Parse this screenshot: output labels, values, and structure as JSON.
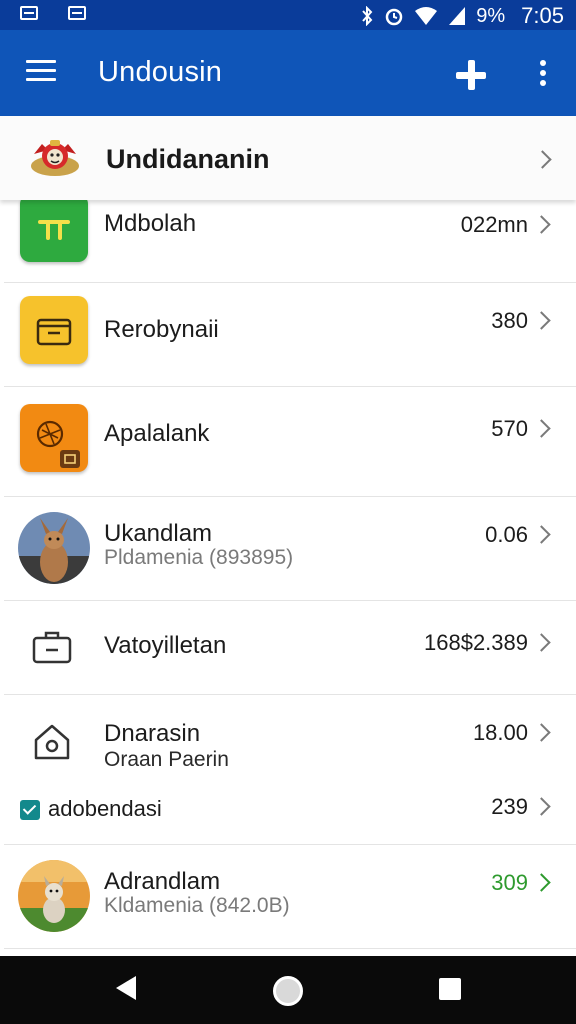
{
  "status_bar": {
    "battery": "9%",
    "time": "7:05",
    "icons": [
      "notification-icon",
      "notification-icon",
      "bluetooth-icon",
      "alarm-icon",
      "wifi-icon",
      "signal-icon"
    ]
  },
  "app_bar": {
    "title": "Undousin",
    "color": "#0f55b8",
    "status_color": "#0a3c9a"
  },
  "header": {
    "title": "Undidananin",
    "icon": "emblem-logo"
  },
  "list": [
    {
      "icon": "green-tile-icon",
      "tile_color": "#2eaa3f",
      "title": "Mdbolah",
      "subtitle": "",
      "value": "022mn"
    },
    {
      "icon": "wallet-icon",
      "tile_color": "#f6c22c",
      "title": "Rerobynaii",
      "subtitle": "",
      "value": "380"
    },
    {
      "icon": "fruit-icon",
      "tile_color": "#f28a12",
      "title": "Apalalank",
      "subtitle": "",
      "value": "570"
    },
    {
      "icon": "kangaroo-avatar",
      "title": "Ukandlam",
      "subtitle": "Pldamenia (893895)",
      "value": "0.06"
    },
    {
      "icon": "briefcase-icon",
      "title": "Vatoyilletan",
      "subtitle": "",
      "value": "168$2.389"
    },
    {
      "icon": "home-icon",
      "title": "Dnarasin",
      "subtitle": "Oraan Paerin",
      "value": "18.00"
    },
    {
      "icon": "checkbox-icon",
      "title": "adobendasi",
      "subtitle": "",
      "value": "239",
      "checked": true
    },
    {
      "icon": "dog-avatar",
      "title": "Adrandlam",
      "subtitle": "Kldamenia (842.0B)",
      "value": "309",
      "value_color": "#2e9a2e"
    }
  ],
  "nav_bar": {
    "buttons": [
      "back-button",
      "home-button",
      "recents-button"
    ]
  }
}
